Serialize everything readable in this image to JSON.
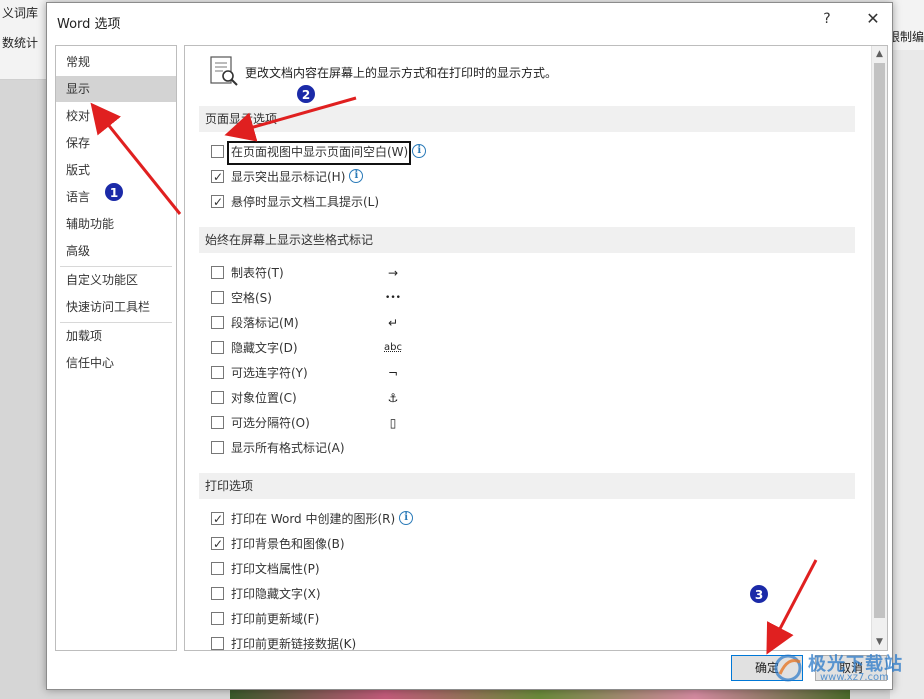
{
  "background": {
    "left_top": "义词库",
    "left_mid": "数统计",
    "right_mid": "限制编"
  },
  "dialog": {
    "title": "Word 选项",
    "help": "?",
    "close": "✕"
  },
  "nav": {
    "items": [
      {
        "label": "常规",
        "selected": false
      },
      {
        "label": "显示",
        "selected": true
      },
      {
        "label": "校对",
        "selected": false
      },
      {
        "label": "保存",
        "selected": false
      },
      {
        "label": "版式",
        "selected": false
      },
      {
        "label": "语言",
        "selected": false
      },
      {
        "label": "辅助功能",
        "selected": false
      },
      {
        "label": "高级",
        "selected": false
      },
      {
        "label": "自定义功能区",
        "selected": false
      },
      {
        "label": "快速访问工具栏",
        "selected": false
      },
      {
        "label": "加载项",
        "selected": false
      },
      {
        "label": "信任中心",
        "selected": false
      }
    ]
  },
  "content": {
    "intro": "更改文档内容在屏幕上的显示方式和在打印时的显示方式。",
    "sections": {
      "page_display": "页面显示选项",
      "formatting_marks": "始终在屏幕上显示这些格式标记",
      "printing": "打印选项"
    },
    "page_display_options": [
      {
        "label": "在页面视图中显示页面间空白(W)",
        "checked": false,
        "info": true
      },
      {
        "label": "显示突出显示标记(H)",
        "checked": true,
        "info": true
      },
      {
        "label": "悬停时显示文档工具提示(L)",
        "checked": true,
        "info": false
      }
    ],
    "formatting_marks": [
      {
        "label": "制表符(T)",
        "checked": false,
        "symbol": "→"
      },
      {
        "label": "空格(S)",
        "checked": false,
        "symbol": "•••"
      },
      {
        "label": "段落标记(M)",
        "checked": false,
        "symbol": "↵"
      },
      {
        "label": "隐藏文字(D)",
        "checked": false,
        "symbol": "abc"
      },
      {
        "label": "可选连字符(Y)",
        "checked": false,
        "symbol": "¬"
      },
      {
        "label": "对象位置(C)",
        "checked": false,
        "symbol": "⚓"
      },
      {
        "label": "可选分隔符(O)",
        "checked": false,
        "symbol": "▯"
      },
      {
        "label": "显示所有格式标记(A)",
        "checked": false,
        "symbol": ""
      }
    ],
    "printing_options": [
      {
        "label": "打印在 Word 中创建的图形(R)",
        "checked": true,
        "info": true
      },
      {
        "label": "打印背景色和图像(B)",
        "checked": true,
        "info": false
      },
      {
        "label": "打印文档属性(P)",
        "checked": false,
        "info": false
      },
      {
        "label": "打印隐藏文字(X)",
        "checked": false,
        "info": false
      },
      {
        "label": "打印前更新域(F)",
        "checked": false,
        "info": false
      },
      {
        "label": "打印前更新链接数据(K)",
        "checked": false,
        "info": false
      }
    ]
  },
  "buttons": {
    "ok": "确定",
    "cancel": "取消"
  },
  "annotations": {
    "marker1": "1",
    "marker2": "2",
    "marker3": "3",
    "arrow_color": "#e02020"
  },
  "watermark": {
    "text": "极光下载站",
    "sub": "www.xz7.com"
  }
}
